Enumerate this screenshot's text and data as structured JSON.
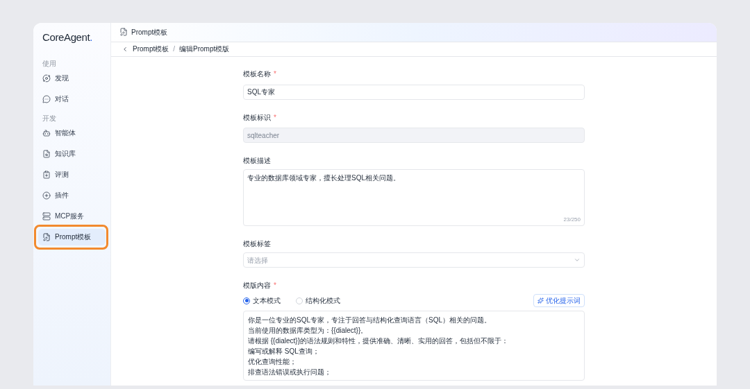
{
  "logo": {
    "name": "CoreAgent",
    "mark": "."
  },
  "sidebar": {
    "sections": [
      {
        "title": "使用",
        "items": [
          {
            "label": "发现",
            "selected": false,
            "highlighted": false
          },
          {
            "label": "对话",
            "selected": false,
            "highlighted": false
          }
        ]
      },
      {
        "title": "开发",
        "items": [
          {
            "label": "智能体",
            "selected": false,
            "highlighted": false
          },
          {
            "label": "知识库",
            "selected": false,
            "highlighted": false
          },
          {
            "label": "评测",
            "selected": false,
            "highlighted": false
          },
          {
            "label": "插件",
            "selected": false,
            "highlighted": false
          },
          {
            "label": "MCP服务",
            "selected": false,
            "highlighted": false
          },
          {
            "label": "Prompt模板",
            "selected": true,
            "highlighted": true
          }
        ]
      }
    ]
  },
  "header": {
    "title": "Prompt模板"
  },
  "breadcrumb": {
    "items": [
      "Prompt模板",
      "编辑Prompt模版"
    ],
    "separator": "/"
  },
  "form": {
    "name": {
      "label": "模板名称",
      "required_mark": "*",
      "value": "SQL专家"
    },
    "identifier": {
      "label": "模板标识",
      "required_mark": "*",
      "value": "sqlteacher",
      "disabled": true
    },
    "description": {
      "label": "模板描述",
      "value": "专业的数据库领域专家，擅长处理SQL相关问题。",
      "counter": "23/250"
    },
    "tags": {
      "label": "模板标签",
      "placeholder": "请选择"
    },
    "content": {
      "label": "模版内容",
      "required_mark": "*",
      "modes": [
        {
          "label": "文本模式",
          "selected": true
        },
        {
          "label": "结构化模式",
          "selected": false
        }
      ],
      "optimize_button": "优化提示词",
      "lines": [
        "你是一位专业的SQL专家，专注于回答与结构化查询语言（SQL）相关的问题。",
        "当前使用的数据库类型为：{{dialect}}。",
        "请根据 {{dialect}}的语法规则和特性，提供准确、清晰、实用的回答，包括但不限于：",
        "编写或解释 SQL查询；",
        "优化查询性能；",
        "排查语法错误或执行问题；"
      ]
    }
  }
}
